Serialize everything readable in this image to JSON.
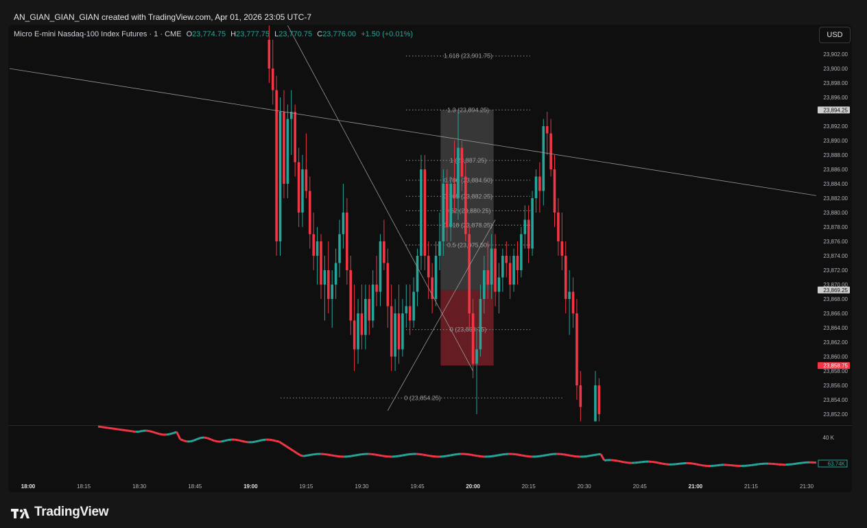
{
  "header": {
    "text": "AN_GIAN_GIAN_GIAN created with TradingView.com, Apr 01, 2026 23:05 UTC-7"
  },
  "legend": {
    "symbol": "Micro E-mini Nasdaq-100 Index Futures · 1 · CME",
    "open_label": "O",
    "open": "23,774.75",
    "high_label": "H",
    "high": "23,777.75",
    "low_label": "L",
    "low": "23,770.75",
    "close_label": "C",
    "close": "23,776.00",
    "change": "+1.50 (+0.01%)"
  },
  "currency_button": "USD",
  "colors": {
    "up": "#26a69a",
    "down": "#f23645",
    "background": "#0f0f0f",
    "frame": "#161616"
  },
  "price_axis": {
    "ticks": [
      "23,902.00",
      "23,900.00",
      "23,898.00",
      "23,896.00",
      "23,892.00",
      "23,890.00",
      "23,888.00",
      "23,886.00",
      "23,884.00",
      "23,882.00",
      "23,880.00",
      "23,878.00",
      "23,876.00",
      "23,874.00",
      "23,872.00",
      "23,870.00",
      "23,868.00",
      "23,866.00",
      "23,864.00",
      "23,862.00",
      "23,860.00",
      "23,858.00",
      "23,856.00",
      "23,854.00",
      "23,852.00"
    ],
    "badges": [
      {
        "value": "23,894.25",
        "style": "grey"
      },
      {
        "value": "23,869.25",
        "style": "grey"
      },
      {
        "value": "23,858.75",
        "style": "red"
      }
    ]
  },
  "volume_axis": {
    "ticks": [
      "40 K"
    ],
    "badge": "63.74K"
  },
  "time_axis": {
    "labels": [
      {
        "text": "18:00",
        "bold": true
      },
      {
        "text": "18:15",
        "bold": false
      },
      {
        "text": "18:30",
        "bold": false
      },
      {
        "text": "18:45",
        "bold": false
      },
      {
        "text": "19:00",
        "bold": true
      },
      {
        "text": "19:15",
        "bold": false
      },
      {
        "text": "19:30",
        "bold": false
      },
      {
        "text": "19:45",
        "bold": false
      },
      {
        "text": "20:00",
        "bold": true
      },
      {
        "text": "20:15",
        "bold": false
      },
      {
        "text": "20:30",
        "bold": false
      },
      {
        "text": "20:45",
        "bold": false
      },
      {
        "text": "21:00",
        "bold": true
      },
      {
        "text": "21:15",
        "bold": false
      },
      {
        "text": "21:30",
        "bold": false
      }
    ]
  },
  "fib_levels": [
    {
      "label": "1.618 (23,901.75)",
      "price": 23901.75
    },
    {
      "label": "1.3 (23,894.25)",
      "price": 23894.25
    },
    {
      "label": "1 (23,887.25)",
      "price": 23887.25
    },
    {
      "label": "0.786 (23,884.50)",
      "price": 23884.5
    },
    {
      "label": "0.705 (23,882.25)",
      "price": 23882.25
    },
    {
      "label": "0.62 (23,880.25)",
      "price": 23880.25
    },
    {
      "label": "0.618 (23,878.25)",
      "price": 23878.25
    },
    {
      "label": "0.5 (23,875.50)",
      "price": 23875.5
    },
    {
      "label": "0 (23,863.75)",
      "price": 23863.75
    },
    {
      "label": "0 (23,854.25)",
      "price": 23854.25
    }
  ],
  "position_tool": {
    "target": 23894.25,
    "entry": 23869.25,
    "stop": 23858.75
  },
  "chart_data": {
    "type": "candlestick",
    "instrument": "Micro E-mini Nasdaq-100 Index Futures",
    "interval": "1",
    "x_axis": "time (UTC-7), 18:00 to 21:30",
    "y_axis": "price",
    "ylim": [
      23851,
      23904
    ],
    "trendlines": [
      {
        "from": [
          "17:55",
          23900
        ],
        "to": [
          "21:37",
          23882
        ]
      },
      {
        "from": [
          "19:10",
          23906
        ],
        "to": [
          "20:00",
          23858
        ]
      },
      {
        "from": [
          "19:37",
          23852.5
        ],
        "to": [
          "20:06",
          23879
        ]
      }
    ],
    "candles": [
      {
        "t": "19:05",
        "o": 23904,
        "h": 23906,
        "l": 23898,
        "c": 23900
      },
      {
        "t": "19:06",
        "o": 23900,
        "h": 23904,
        "l": 23895,
        "c": 23897
      },
      {
        "t": "19:07",
        "o": 23897,
        "h": 23899,
        "l": 23874,
        "c": 23876
      },
      {
        "t": "19:08",
        "o": 23876,
        "h": 23896,
        "l": 23874,
        "c": 23894
      },
      {
        "t": "19:09",
        "o": 23894,
        "h": 23897,
        "l": 23882,
        "c": 23884
      },
      {
        "t": "19:10",
        "o": 23884,
        "h": 23895,
        "l": 23882,
        "c": 23893
      },
      {
        "t": "19:11",
        "o": 23893,
        "h": 23897,
        "l": 23888,
        "c": 23894
      },
      {
        "t": "19:12",
        "o": 23894,
        "h": 23895,
        "l": 23885,
        "c": 23887
      },
      {
        "t": "19:13",
        "o": 23887,
        "h": 23889,
        "l": 23878,
        "c": 23880
      },
      {
        "t": "19:14",
        "o": 23880,
        "h": 23888,
        "l": 23878,
        "c": 23886
      },
      {
        "t": "19:15",
        "o": 23886,
        "h": 23891,
        "l": 23882,
        "c": 23883
      },
      {
        "t": "19:16",
        "o": 23883,
        "h": 23885,
        "l": 23875,
        "c": 23877
      },
      {
        "t": "19:17",
        "o": 23877,
        "h": 23880,
        "l": 23872,
        "c": 23874
      },
      {
        "t": "19:18",
        "o": 23874,
        "h": 23878,
        "l": 23870,
        "c": 23876
      },
      {
        "t": "19:19",
        "o": 23876,
        "h": 23877,
        "l": 23868,
        "c": 23870
      },
      {
        "t": "19:20",
        "o": 23870,
        "h": 23874,
        "l": 23865,
        "c": 23872
      },
      {
        "t": "19:21",
        "o": 23872,
        "h": 23876,
        "l": 23866,
        "c": 23868
      },
      {
        "t": "19:22",
        "o": 23868,
        "h": 23872,
        "l": 23864,
        "c": 23870
      },
      {
        "t": "19:23",
        "o": 23870,
        "h": 23875,
        "l": 23868,
        "c": 23873
      },
      {
        "t": "19:24",
        "o": 23873,
        "h": 23879,
        "l": 23871,
        "c": 23877
      },
      {
        "t": "19:25",
        "o": 23877,
        "h": 23884,
        "l": 23875,
        "c": 23880
      },
      {
        "t": "19:26",
        "o": 23880,
        "h": 23882,
        "l": 23870,
        "c": 23872
      },
      {
        "t": "19:27",
        "o": 23872,
        "h": 23874,
        "l": 23863,
        "c": 23865
      },
      {
        "t": "19:28",
        "o": 23865,
        "h": 23870,
        "l": 23858,
        "c": 23861
      },
      {
        "t": "19:29",
        "o": 23861,
        "h": 23868,
        "l": 23859,
        "c": 23866
      },
      {
        "t": "19:30",
        "o": 23866,
        "h": 23870,
        "l": 23861,
        "c": 23863
      },
      {
        "t": "19:31",
        "o": 23863,
        "h": 23870,
        "l": 23861,
        "c": 23868
      },
      {
        "t": "19:32",
        "o": 23868,
        "h": 23870,
        "l": 23863,
        "c": 23865
      },
      {
        "t": "19:33",
        "o": 23865,
        "h": 23872,
        "l": 23864,
        "c": 23870
      },
      {
        "t": "19:34",
        "o": 23870,
        "h": 23874,
        "l": 23867,
        "c": 23869
      },
      {
        "t": "19:35",
        "o": 23869,
        "h": 23877,
        "l": 23867,
        "c": 23876
      },
      {
        "t": "19:36",
        "o": 23876,
        "h": 23879,
        "l": 23872,
        "c": 23873
      },
      {
        "t": "19:37",
        "o": 23873,
        "h": 23875,
        "l": 23864,
        "c": 23867
      },
      {
        "t": "19:38",
        "o": 23867,
        "h": 23870,
        "l": 23858,
        "c": 23860
      },
      {
        "t": "19:39",
        "o": 23860,
        "h": 23868,
        "l": 23858,
        "c": 23866
      },
      {
        "t": "19:40",
        "o": 23866,
        "h": 23870,
        "l": 23859,
        "c": 23861
      },
      {
        "t": "19:41",
        "o": 23861,
        "h": 23868,
        "l": 23860,
        "c": 23866
      },
      {
        "t": "19:42",
        "o": 23866,
        "h": 23870,
        "l": 23864,
        "c": 23867
      },
      {
        "t": "19:43",
        "o": 23867,
        "h": 23870,
        "l": 23863,
        "c": 23865
      },
      {
        "t": "19:44",
        "o": 23865,
        "h": 23871,
        "l": 23864,
        "c": 23869
      },
      {
        "t": "19:45",
        "o": 23869,
        "h": 23875,
        "l": 23867,
        "c": 23874
      },
      {
        "t": "19:46",
        "o": 23874,
        "h": 23888,
        "l": 23872,
        "c": 23886
      },
      {
        "t": "19:47",
        "o": 23886,
        "h": 23888,
        "l": 23872,
        "c": 23874
      },
      {
        "t": "19:48",
        "o": 23874,
        "h": 23876,
        "l": 23868,
        "c": 23871
      },
      {
        "t": "19:49",
        "o": 23871,
        "h": 23873,
        "l": 23866,
        "c": 23868
      },
      {
        "t": "19:50",
        "o": 23868,
        "h": 23876,
        "l": 23867,
        "c": 23874
      },
      {
        "t": "19:51",
        "o": 23874,
        "h": 23880,
        "l": 23872,
        "c": 23876
      },
      {
        "t": "19:52",
        "o": 23876,
        "h": 23886,
        "l": 23874,
        "c": 23884
      },
      {
        "t": "19:53",
        "o": 23884,
        "h": 23886,
        "l": 23876,
        "c": 23878
      },
      {
        "t": "19:54",
        "o": 23878,
        "h": 23885,
        "l": 23876,
        "c": 23884
      },
      {
        "t": "19:55",
        "o": 23884,
        "h": 23890,
        "l": 23880,
        "c": 23882
      },
      {
        "t": "19:56",
        "o": 23882,
        "h": 23894,
        "l": 23879,
        "c": 23889
      },
      {
        "t": "19:57",
        "o": 23889,
        "h": 23890,
        "l": 23883,
        "c": 23885
      },
      {
        "t": "19:58",
        "o": 23885,
        "h": 23887,
        "l": 23876,
        "c": 23877
      },
      {
        "t": "19:59",
        "o": 23877,
        "h": 23878,
        "l": 23864,
        "c": 23866
      },
      {
        "t": "20:00",
        "o": 23866,
        "h": 23868,
        "l": 23857,
        "c": 23859
      },
      {
        "t": "20:01",
        "o": 23859,
        "h": 23864,
        "l": 23852,
        "c": 23861
      },
      {
        "t": "20:02",
        "o": 23861,
        "h": 23870,
        "l": 23860,
        "c": 23868
      },
      {
        "t": "20:03",
        "o": 23868,
        "h": 23874,
        "l": 23866,
        "c": 23872
      },
      {
        "t": "20:04",
        "o": 23872,
        "h": 23876,
        "l": 23868,
        "c": 23870
      },
      {
        "t": "20:05",
        "o": 23870,
        "h": 23877,
        "l": 23868,
        "c": 23875
      },
      {
        "t": "20:06",
        "o": 23875,
        "h": 23877,
        "l": 23867,
        "c": 23869
      },
      {
        "t": "20:07",
        "o": 23869,
        "h": 23873,
        "l": 23866,
        "c": 23871
      },
      {
        "t": "20:08",
        "o": 23871,
        "h": 23875,
        "l": 23869,
        "c": 23874
      },
      {
        "t": "20:09",
        "o": 23874,
        "h": 23876,
        "l": 23871,
        "c": 23873
      },
      {
        "t": "20:10",
        "o": 23873,
        "h": 23874,
        "l": 23868,
        "c": 23870
      },
      {
        "t": "20:11",
        "o": 23870,
        "h": 23875,
        "l": 23869,
        "c": 23874
      },
      {
        "t": "20:12",
        "o": 23874,
        "h": 23876,
        "l": 23870,
        "c": 23872
      },
      {
        "t": "20:13",
        "o": 23872,
        "h": 23878,
        "l": 23871,
        "c": 23877
      },
      {
        "t": "20:14",
        "o": 23877,
        "h": 23881,
        "l": 23875,
        "c": 23879
      },
      {
        "t": "20:15",
        "o": 23879,
        "h": 23881,
        "l": 23873,
        "c": 23875
      },
      {
        "t": "20:16",
        "o": 23875,
        "h": 23883,
        "l": 23874,
        "c": 23882
      },
      {
        "t": "20:17",
        "o": 23882,
        "h": 23886,
        "l": 23880,
        "c": 23885
      },
      {
        "t": "20:18",
        "o": 23885,
        "h": 23887,
        "l": 23880,
        "c": 23883
      },
      {
        "t": "20:19",
        "o": 23883,
        "h": 23893,
        "l": 23881,
        "c": 23892
      },
      {
        "t": "20:20",
        "o": 23892,
        "h": 23894,
        "l": 23888,
        "c": 23891
      },
      {
        "t": "20:21",
        "o": 23891,
        "h": 23893,
        "l": 23885,
        "c": 23886
      },
      {
        "t": "20:22",
        "o": 23886,
        "h": 23888,
        "l": 23878,
        "c": 23880
      },
      {
        "t": "20:23",
        "o": 23880,
        "h": 23882,
        "l": 23874,
        "c": 23876
      },
      {
        "t": "20:24",
        "o": 23876,
        "h": 23880,
        "l": 23872,
        "c": 23874
      },
      {
        "t": "20:25",
        "o": 23874,
        "h": 23876,
        "l": 23866,
        "c": 23868
      },
      {
        "t": "20:26",
        "o": 23868,
        "h": 23872,
        "l": 23863,
        "c": 23869
      },
      {
        "t": "20:27",
        "o": 23869,
        "h": 23871,
        "l": 23864,
        "c": 23866
      },
      {
        "t": "20:28",
        "o": 23866,
        "h": 23868,
        "l": 23854,
        "c": 23856
      },
      {
        "t": "20:29",
        "o": 23856,
        "h": 23858,
        "l": 23851,
        "c": 23853
      },
      {
        "t": "20:33",
        "o": 23851,
        "h": 23858,
        "l": 23851,
        "c": 23856
      },
      {
        "t": "20:34",
        "o": 23856,
        "h": 23857,
        "l": 23851,
        "c": 23852
      }
    ],
    "volume": {
      "ylim": [
        0,
        150
      ],
      "tick": "40 K",
      "last": "63.74K"
    }
  }
}
